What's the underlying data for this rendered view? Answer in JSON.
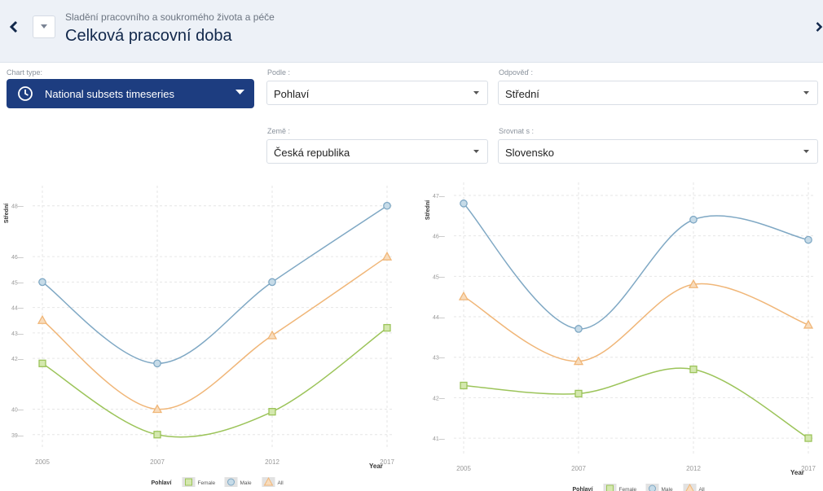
{
  "header": {
    "breadcrumb": "Sladění pracovního a soukromého života a péče",
    "title": "Celková pracovní doba"
  },
  "controls": {
    "chart_type_label": "Chart type:",
    "chart_type_value": "National subsets timeseries",
    "podle_label": "Podle :",
    "podle_value": "Pohlaví",
    "odpoved_label": "Odpověď :",
    "odpoved_value": "Střední",
    "zeme_label": "Země :",
    "zeme_value": "Česká republika",
    "srovnat_label": "Srovnat s :",
    "srovnat_value": "Slovensko"
  },
  "legend": {
    "title": "Pohlaví",
    "items": [
      "Female",
      "Male",
      "All"
    ]
  },
  "colors": {
    "female": "#9cc45a",
    "male": "#7fa8c4",
    "all": "#f0b678",
    "accent": "#1d3d80"
  },
  "chart_data": [
    {
      "type": "line",
      "ylabel": "Střední",
      "xlabel": "Year",
      "x": [
        "2005",
        "2007",
        "2012",
        "2017"
      ],
      "yticks": [
        39,
        40,
        42,
        43,
        44,
        45,
        46,
        48
      ],
      "ylim": [
        38.8,
        48.6
      ],
      "series": [
        {
          "name": "Female",
          "values": [
            41.8,
            39.0,
            39.9,
            43.2
          ]
        },
        {
          "name": "Male",
          "values": [
            45.0,
            41.8,
            45.0,
            48.0
          ]
        },
        {
          "name": "All",
          "values": [
            43.5,
            40.0,
            42.9,
            46.0
          ]
        }
      ]
    },
    {
      "type": "line",
      "ylabel": "Střední",
      "xlabel": "Year",
      "x": [
        "2005",
        "2007",
        "2012",
        "2017"
      ],
      "yticks": [
        41,
        42,
        43,
        44,
        45,
        46,
        47
      ],
      "ylim": [
        40.8,
        47.2
      ],
      "series": [
        {
          "name": "Female",
          "values": [
            42.3,
            42.1,
            42.7,
            41.0
          ]
        },
        {
          "name": "Male",
          "values": [
            46.8,
            43.7,
            46.4,
            45.9
          ]
        },
        {
          "name": "All",
          "values": [
            44.5,
            42.9,
            44.8,
            43.8
          ]
        }
      ]
    }
  ]
}
